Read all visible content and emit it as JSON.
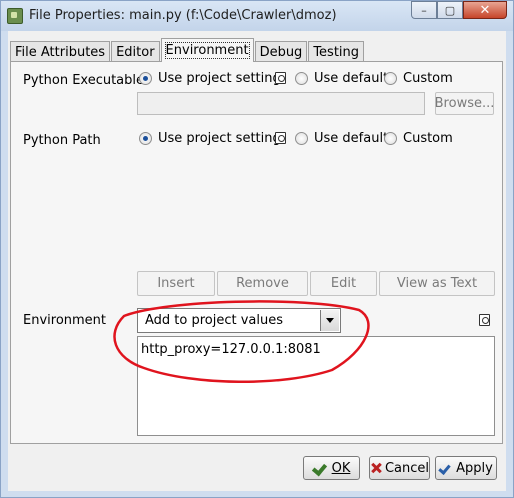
{
  "window": {
    "title": "File Properties: main.py (f:\\Code\\Crawler\\dmoz)",
    "buttons": {
      "minimize": "–",
      "maximize": "▢",
      "close": "✕"
    }
  },
  "tabs": [
    {
      "label": "File Attributes",
      "active": false
    },
    {
      "label": "Editor",
      "active": false
    },
    {
      "label": "Environment",
      "active": true
    },
    {
      "label": "Debug",
      "active": false
    },
    {
      "label": "Testing",
      "active": false
    }
  ],
  "python_executable": {
    "label": "Python Executable",
    "options": {
      "project": "Use project setting",
      "default": "Use default",
      "custom": "Custom"
    },
    "selected": "project",
    "path_value": "",
    "browse_label": "Browse..."
  },
  "python_path": {
    "label": "Python Path",
    "options": {
      "project": "Use project setting",
      "default": "Use default",
      "custom": "Custom"
    },
    "selected": "project"
  },
  "path_buttons": {
    "insert": "Insert",
    "remove": "Remove",
    "edit": "Edit",
    "view_as_text": "View as Text"
  },
  "environment": {
    "label": "Environment",
    "mode": "Add to project values",
    "text": "http_proxy=127.0.0.1:8081"
  },
  "dialog_buttons": {
    "ok": "OK",
    "cancel": "Cancel",
    "apply": "Apply"
  },
  "colors": {
    "annotation": "#e0141e",
    "title_bar": "#cfddef"
  }
}
